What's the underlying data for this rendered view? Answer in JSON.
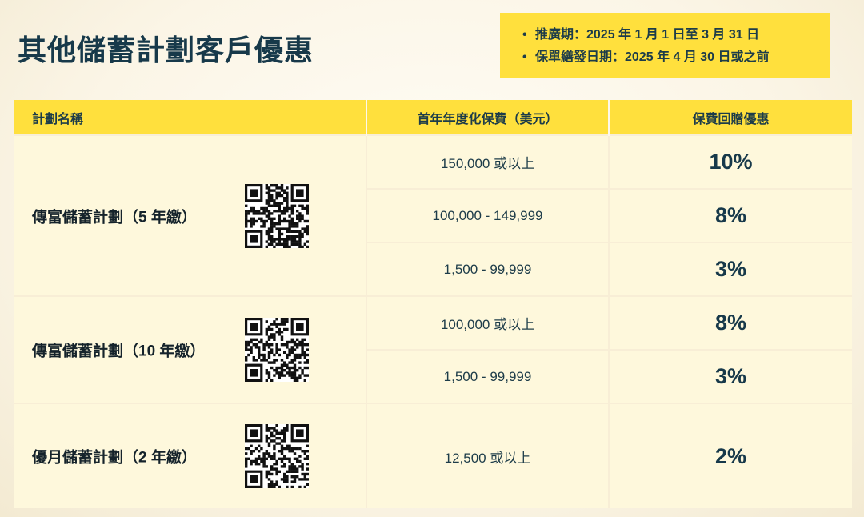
{
  "title": "其他儲蓄計劃客戶優惠",
  "promo": {
    "bullet": "•",
    "lines": [
      "推廣期：2025 年 1 月 1 日至 3 月 31 日",
      "保單繕發日期：2025 年 4 月 30 日或之前"
    ]
  },
  "table": {
    "headers": [
      "計劃名稱",
      "首年年度化保費（美元）",
      "保費回贈優惠"
    ],
    "plans": [
      {
        "name": "傳富儲蓄計劃（5 年繳）",
        "qr_icon": "qr-code-icon",
        "tiers": [
          {
            "premium": "150,000 或以上",
            "rebate": "10%"
          },
          {
            "premium": "100,000 - 149,999",
            "rebate": "8%"
          },
          {
            "premium": "1,500 - 99,999",
            "rebate": "3%"
          }
        ]
      },
      {
        "name": "傳富儲蓄計劃（10 年繳）",
        "qr_icon": "qr-code-icon",
        "tiers": [
          {
            "premium": "100,000 或以上",
            "rebate": "8%"
          },
          {
            "premium": "1,500 - 99,999",
            "rebate": "3%"
          }
        ]
      },
      {
        "name": "優月儲蓄計劃（2 年繳）",
        "qr_icon": "qr-code-icon",
        "tiers": [
          {
            "premium": "12,500 或以上",
            "rebate": "2%"
          }
        ]
      }
    ]
  },
  "colors": {
    "accent_yellow": "#ffe03d",
    "text_navy": "#17394a",
    "row_bg": "#fef8dc"
  }
}
